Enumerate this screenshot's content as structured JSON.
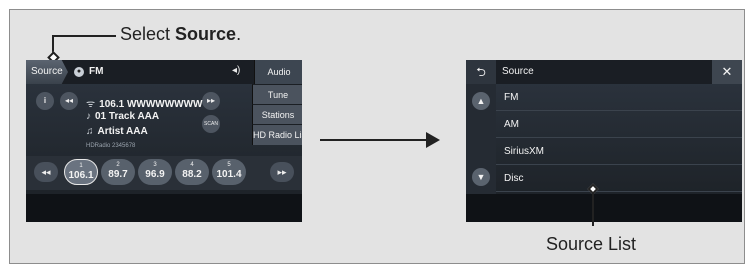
{
  "callout": {
    "prefix": "Select ",
    "bold": "Source",
    "suffix": "."
  },
  "left_screen": {
    "source_tab": "Source",
    "band_label": "FM",
    "audio_menu_label": "Audio Menu",
    "menu_items": [
      "Tune",
      "Stations",
      "HD Radio List"
    ],
    "station_line": "106.1 WWWWWWWW",
    "track_line": "01 Track AAA",
    "artist_line": "Artist AAA",
    "hd_line": "HDRadio  2345678",
    "scan_label": "SCAN",
    "presets": [
      {
        "num": "1",
        "freq": "106.1",
        "selected": true
      },
      {
        "num": "2",
        "freq": "89.7",
        "selected": false
      },
      {
        "num": "3",
        "freq": "96.9",
        "selected": false
      },
      {
        "num": "4",
        "freq": "88.2",
        "selected": false
      },
      {
        "num": "5",
        "freq": "101.4",
        "selected": false
      }
    ],
    "page_dots": 3,
    "active_dot": 0
  },
  "right_screen": {
    "title": "Source",
    "items": [
      "FM",
      "AM",
      "SiriusXM",
      "Disc"
    ]
  },
  "source_list_label": "Source List",
  "icons": {
    "back": "back-arrow-icon",
    "close": "close-icon",
    "scroll_up": "scroll-up-icon",
    "scroll_down": "scroll-down-icon",
    "info": "info-icon",
    "seek_back": "seek-back-icon",
    "seek_forward": "seek-forward-icon",
    "volume": "volume-icon",
    "band": "band-icon"
  }
}
